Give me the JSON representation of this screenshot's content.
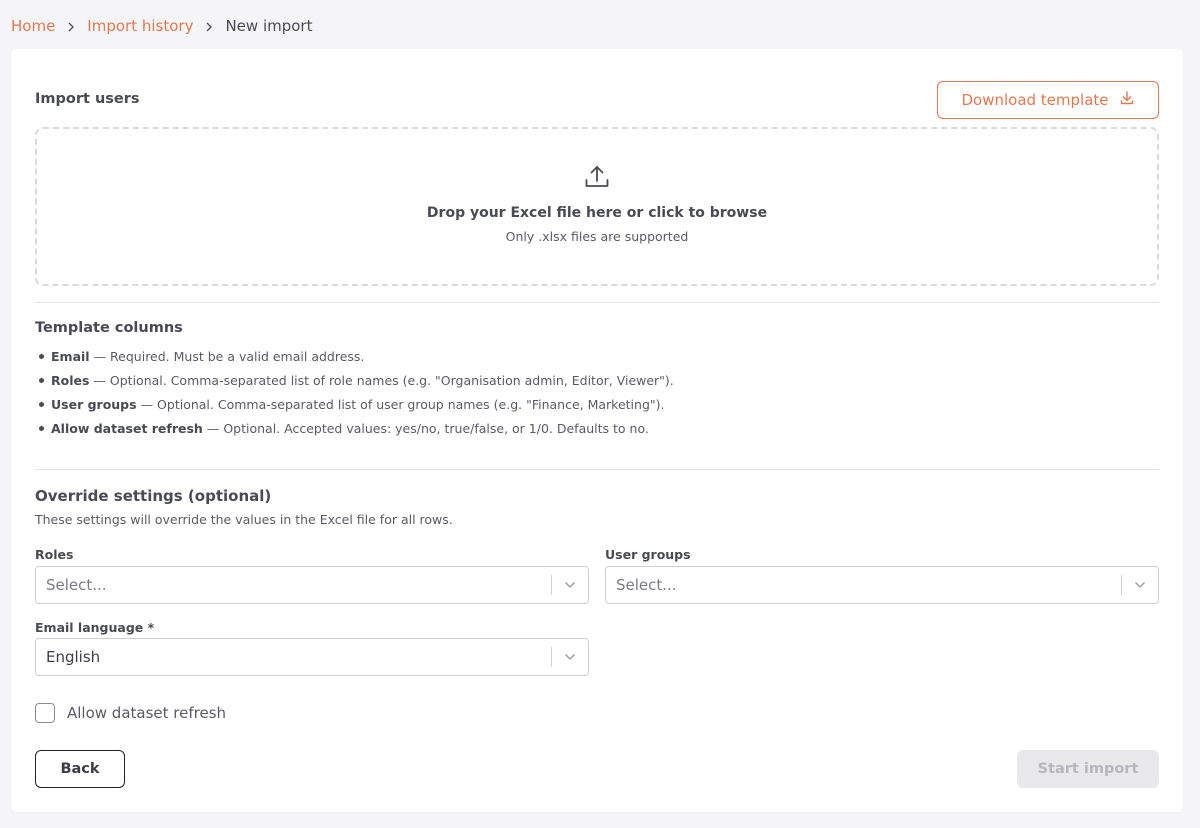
{
  "breadcrumb": {
    "home": "Home",
    "import_history": "Import history",
    "current": "New import"
  },
  "import_section": {
    "title": "Import users",
    "download_template_label": "Download template"
  },
  "dropzone": {
    "title": "Drop your Excel file here or click to browse",
    "subtitle": "Only .xlsx files are supported"
  },
  "template_columns": {
    "title": "Template columns",
    "items": [
      {
        "name": "Email",
        "description": "— Required. Must be a valid email address."
      },
      {
        "name": "Roles",
        "description": "— Optional. Comma-separated list of role names (e.g. \"Organisation admin, Editor, Viewer\")."
      },
      {
        "name": "User groups",
        "description": "— Optional. Comma-separated list of user group names (e.g. \"Finance, Marketing\")."
      },
      {
        "name": "Allow dataset refresh",
        "description": "— Optional. Accepted values: yes/no, true/false, or 1/0. Defaults to no."
      }
    ]
  },
  "override": {
    "title": "Override settings (optional)",
    "subtitle": "These settings will override the values in the Excel file for all rows.",
    "roles": {
      "label": "Roles",
      "placeholder": "Select..."
    },
    "user_groups": {
      "label": "User groups",
      "placeholder": "Select..."
    },
    "email_language": {
      "label": "Email language *",
      "value": "English"
    },
    "allow_dataset_refresh": {
      "label": "Allow dataset refresh",
      "checked": false
    }
  },
  "actions": {
    "back_label": "Back",
    "start_import_label": "Start import"
  },
  "colors": {
    "accent": "#e07a52",
    "background": "#f5f5f8",
    "disabled_button": "#e8e8eb"
  },
  "icons": {
    "breadcrumb_separator": "chevron-right-icon",
    "download": "download-icon",
    "upload": "upload-icon",
    "select_arrow": "chevron-down-icon"
  }
}
